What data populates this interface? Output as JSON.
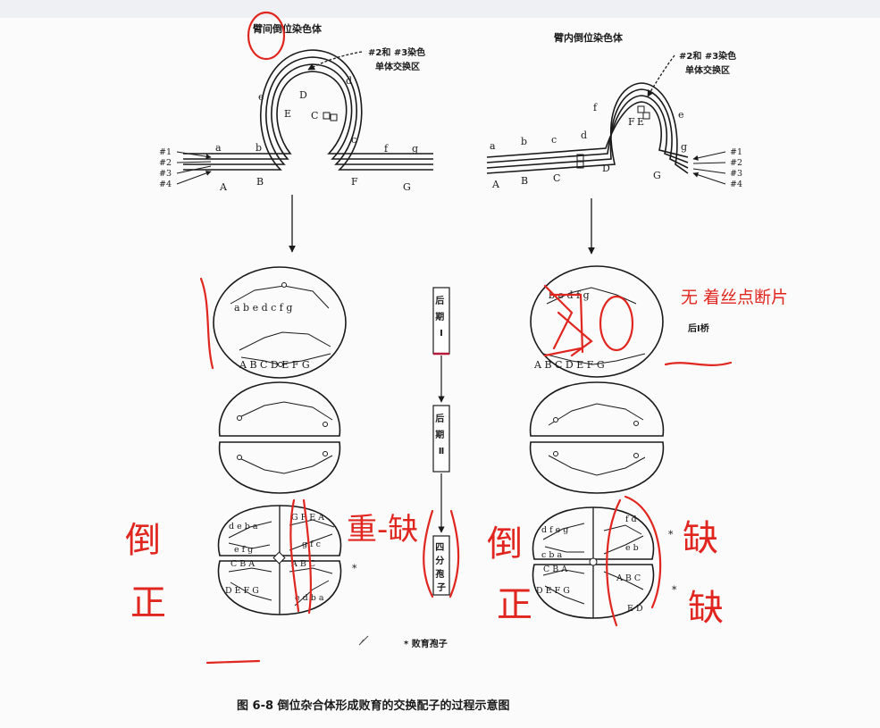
{
  "titles": {
    "left": "臂间倒位染色体",
    "right": "臂内倒位染色体",
    "exchange_left": [
      "#2和 #3染色",
      "单体交换区"
    ],
    "exchange_right": [
      "#2和 #3染色",
      "单体交换区"
    ]
  },
  "strand_labels": [
    "#1",
    "#2",
    "#3",
    "#4"
  ],
  "stages": {
    "anaphase1": "后期Ⅰ",
    "anaphase2": "后期Ⅱ",
    "tetrad": "四分孢子"
  },
  "bridge_label": "后Ⅰ桥",
  "footnote": "* 败育孢子",
  "caption": "图  6-8    倒位杂合体形成败育的交换配子的过程示意图",
  "genes_left": {
    "upper": [
      "a",
      "b",
      "e",
      "d",
      "c",
      "f",
      "g"
    ],
    "lower": [
      "A",
      "B",
      "E",
      "D",
      "C",
      "F",
      "G"
    ],
    "meta_upper": "a b e d c f g",
    "meta_lower": "A B C D E F G",
    "tetrad_top": [
      "d e b a",
      "G F E A",
      "e f g",
      "g f c"
    ],
    "tetrad_bottom": [
      "C B A",
      "A B C",
      "D E F G",
      "e d b a"
    ]
  },
  "genes_right": {
    "upper": [
      "a",
      "b",
      "c",
      "d",
      "f",
      "e",
      "g"
    ],
    "lower": [
      "A",
      "B",
      "C",
      "D",
      "F",
      "E",
      "G"
    ],
    "meta_upper": "b e d f g",
    "meta_lower": "A B C D E F G",
    "tetrad_top": [
      "d f e g",
      "f d",
      "c b a",
      "e b"
    ],
    "tetrad_bottom": [
      "C B A",
      "A B C",
      "D E F G",
      "E D"
    ]
  },
  "annotations": {
    "no_centromere": "无 着丝点断片",
    "left_inverted": "倒",
    "left_normal": "正",
    "middle": "重-缺",
    "right_inverted": "倒",
    "right_normal": "正",
    "right_deficient_top": "缺",
    "right_deficient_bottom": "缺"
  },
  "colors": {
    "ink": "#1a1a1a",
    "annotation": "#e0261f",
    "stage_box_edge": "#b7193a"
  }
}
